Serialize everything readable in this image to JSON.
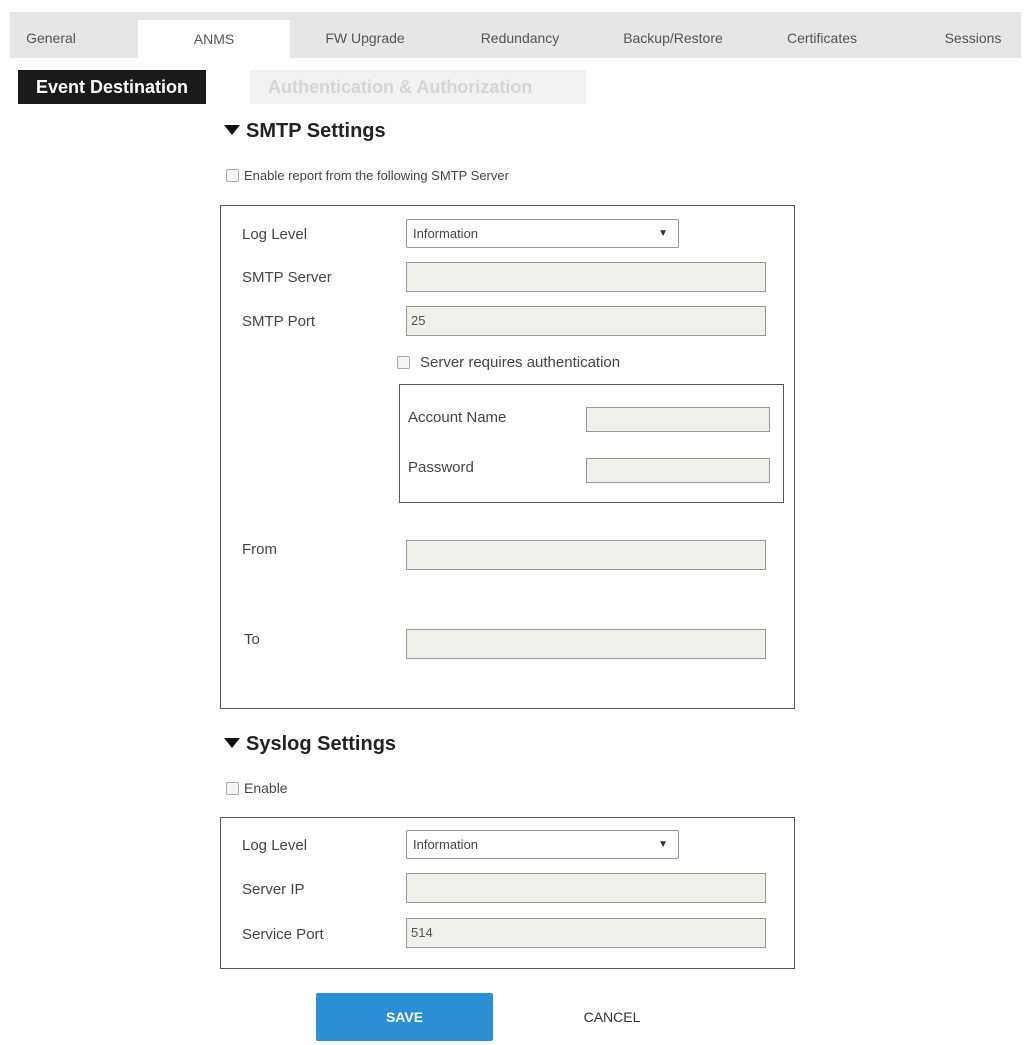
{
  "tabs": [
    "General",
    "ANMS",
    "FW Upgrade",
    "Redundancy",
    "Backup/Restore",
    "Certificates",
    "Sessions"
  ],
  "subtabs": {
    "active": "Event Destination",
    "inactive": "Authentication & Authorization"
  },
  "smtp": {
    "title": "SMTP Settings",
    "enable_label": "Enable report from the following SMTP Server",
    "log_level_label": "Log Level",
    "log_level_value": "Information",
    "server_label": "SMTP Server",
    "server_value": "",
    "port_label": "SMTP Port",
    "port_value": "25",
    "auth_label": "Server requires authentication",
    "account_label": "Account Name",
    "account_value": "",
    "password_label": "Password",
    "password_value": "",
    "from_label": "From",
    "from_value": "",
    "to_label": "To",
    "to_value": ""
  },
  "syslog": {
    "title": "Syslog Settings",
    "enable_label": "Enable",
    "log_level_label": "Log Level",
    "log_level_value": "Information",
    "server_ip_label": "Server IP",
    "server_ip_value": "",
    "port_label": "Service Port",
    "port_value": "514"
  },
  "buttons": {
    "save": "SAVE",
    "cancel": "CANCEL"
  }
}
